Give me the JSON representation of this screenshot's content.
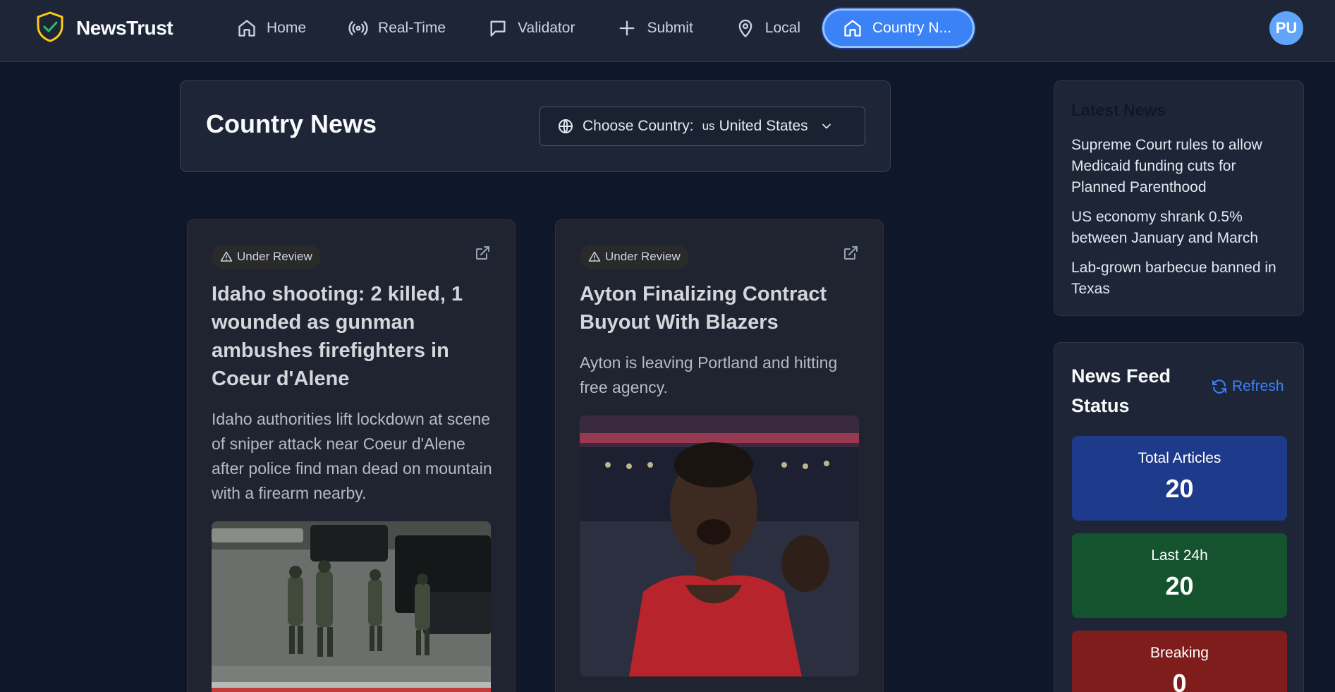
{
  "brand": {
    "name": "NewsTrust",
    "logo_icon": "shield-check-icon",
    "logo_color": "#facc15"
  },
  "nav": {
    "items": [
      {
        "label": "Home",
        "icon": "home-icon"
      },
      {
        "label": "Real-Time",
        "icon": "broadcast-icon"
      },
      {
        "label": "Validator",
        "icon": "message-square-icon"
      },
      {
        "label": "Submit",
        "icon": "plus-icon"
      },
      {
        "label": "Local",
        "icon": "map-pin-icon"
      }
    ],
    "active": {
      "label": "Country N...",
      "icon": "home-icon",
      "color": "#3b82f6"
    }
  },
  "user": {
    "initials": "PU"
  },
  "header": {
    "title": "Country News",
    "country_select": {
      "label": "Choose Country:",
      "code": "us",
      "value": "United States"
    }
  },
  "articles": [
    {
      "badge": "Under Review",
      "title": "Idaho shooting: 2 killed, 1 wounded as gunman ambushes firefighters in Coeur d'Alene",
      "description": "Idaho authorities lift lockdown at scene of sniper attack near Coeur d'Alene after police find man dead on mountain with a firearm nearby."
    },
    {
      "badge": "Under Review",
      "title": "Ayton Finalizing Contract Buyout With Blazers",
      "description": "Ayton is leaving Portland and hitting free agency."
    }
  ],
  "latest_news": {
    "title": "Latest News",
    "items": [
      "Supreme Court rules to allow Medicaid funding cuts for Planned Parenthood",
      "US economy shrank 0.5% between January and March",
      "Lab-grown barbecue banned in Texas"
    ]
  },
  "feed_status": {
    "title": "News Feed Status",
    "refresh_label": "Refresh",
    "stats": [
      {
        "label": "Total Articles",
        "value": "20",
        "color": "#1e3a8a"
      },
      {
        "label": "Last 24h",
        "value": "20",
        "color": "#14532d"
      },
      {
        "label": "Breaking",
        "value": "0",
        "color": "#7f1d1d"
      }
    ]
  }
}
